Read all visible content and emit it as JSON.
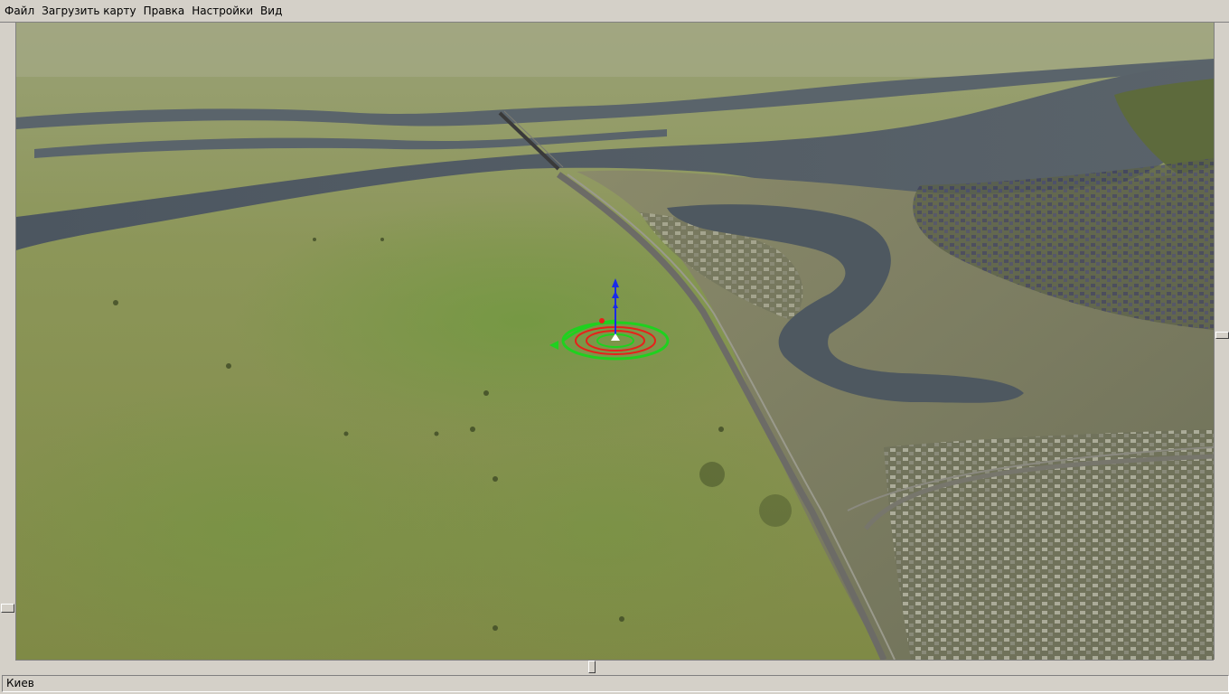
{
  "menu": {
    "file": "Файл",
    "load_map": "Загрузить карту",
    "edit": "Правка",
    "settings": "Настройки",
    "view": "Вид"
  },
  "status": {
    "location": "Киев"
  },
  "viewport": {
    "description_icon": "3d-terrain-view",
    "gizmo_axes": [
      "x-axis-green",
      "y-axis-blue",
      "z-axis-red"
    ],
    "colors": {
      "gizmo_green": "#1fd11f",
      "gizmo_red": "#e8201a",
      "gizmo_blue": "#1a2be8"
    }
  }
}
